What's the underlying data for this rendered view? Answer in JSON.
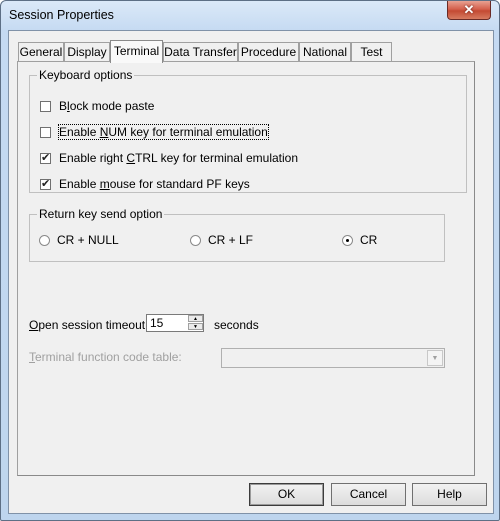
{
  "window": {
    "title": "Session Properties",
    "close_icon": "close-icon"
  },
  "tabs": [
    {
      "label": "General",
      "active": false
    },
    {
      "label": "Display",
      "active": false
    },
    {
      "label": "Terminal",
      "active": true
    },
    {
      "label": "Data Transfer",
      "active": false
    },
    {
      "label": "Procedure",
      "active": false
    },
    {
      "label": "National",
      "active": false
    },
    {
      "label": "Test",
      "active": false
    }
  ],
  "keyboard_options": {
    "title": "Keyboard options",
    "items": [
      {
        "pre": "B",
        "u": "l",
        "post": "ock mode paste",
        "checked": false
      },
      {
        "pre": "Enable ",
        "u": "N",
        "post": "UM key for terminal emulation",
        "checked": false
      },
      {
        "pre": "Enable right ",
        "u": "C",
        "post": "TRL key for terminal emulation",
        "checked": true
      },
      {
        "pre": "Enable ",
        "u": "m",
        "post": "ouse for standard PF keys",
        "checked": true
      }
    ]
  },
  "return_key": {
    "title": "Return key send option",
    "options": [
      {
        "label": "CR + NULL",
        "selected": false
      },
      {
        "label": "CR + LF",
        "selected": false
      },
      {
        "label": "CR",
        "selected": true
      }
    ]
  },
  "timeout": {
    "label_u": "O",
    "label_rest": "pen session timeout:",
    "value": "15",
    "units": "seconds"
  },
  "function_table": {
    "label_u": "T",
    "label_rest": "erminal function code table:",
    "value": ""
  },
  "buttons": {
    "ok": "OK",
    "cancel": "Cancel",
    "help": "Help"
  }
}
